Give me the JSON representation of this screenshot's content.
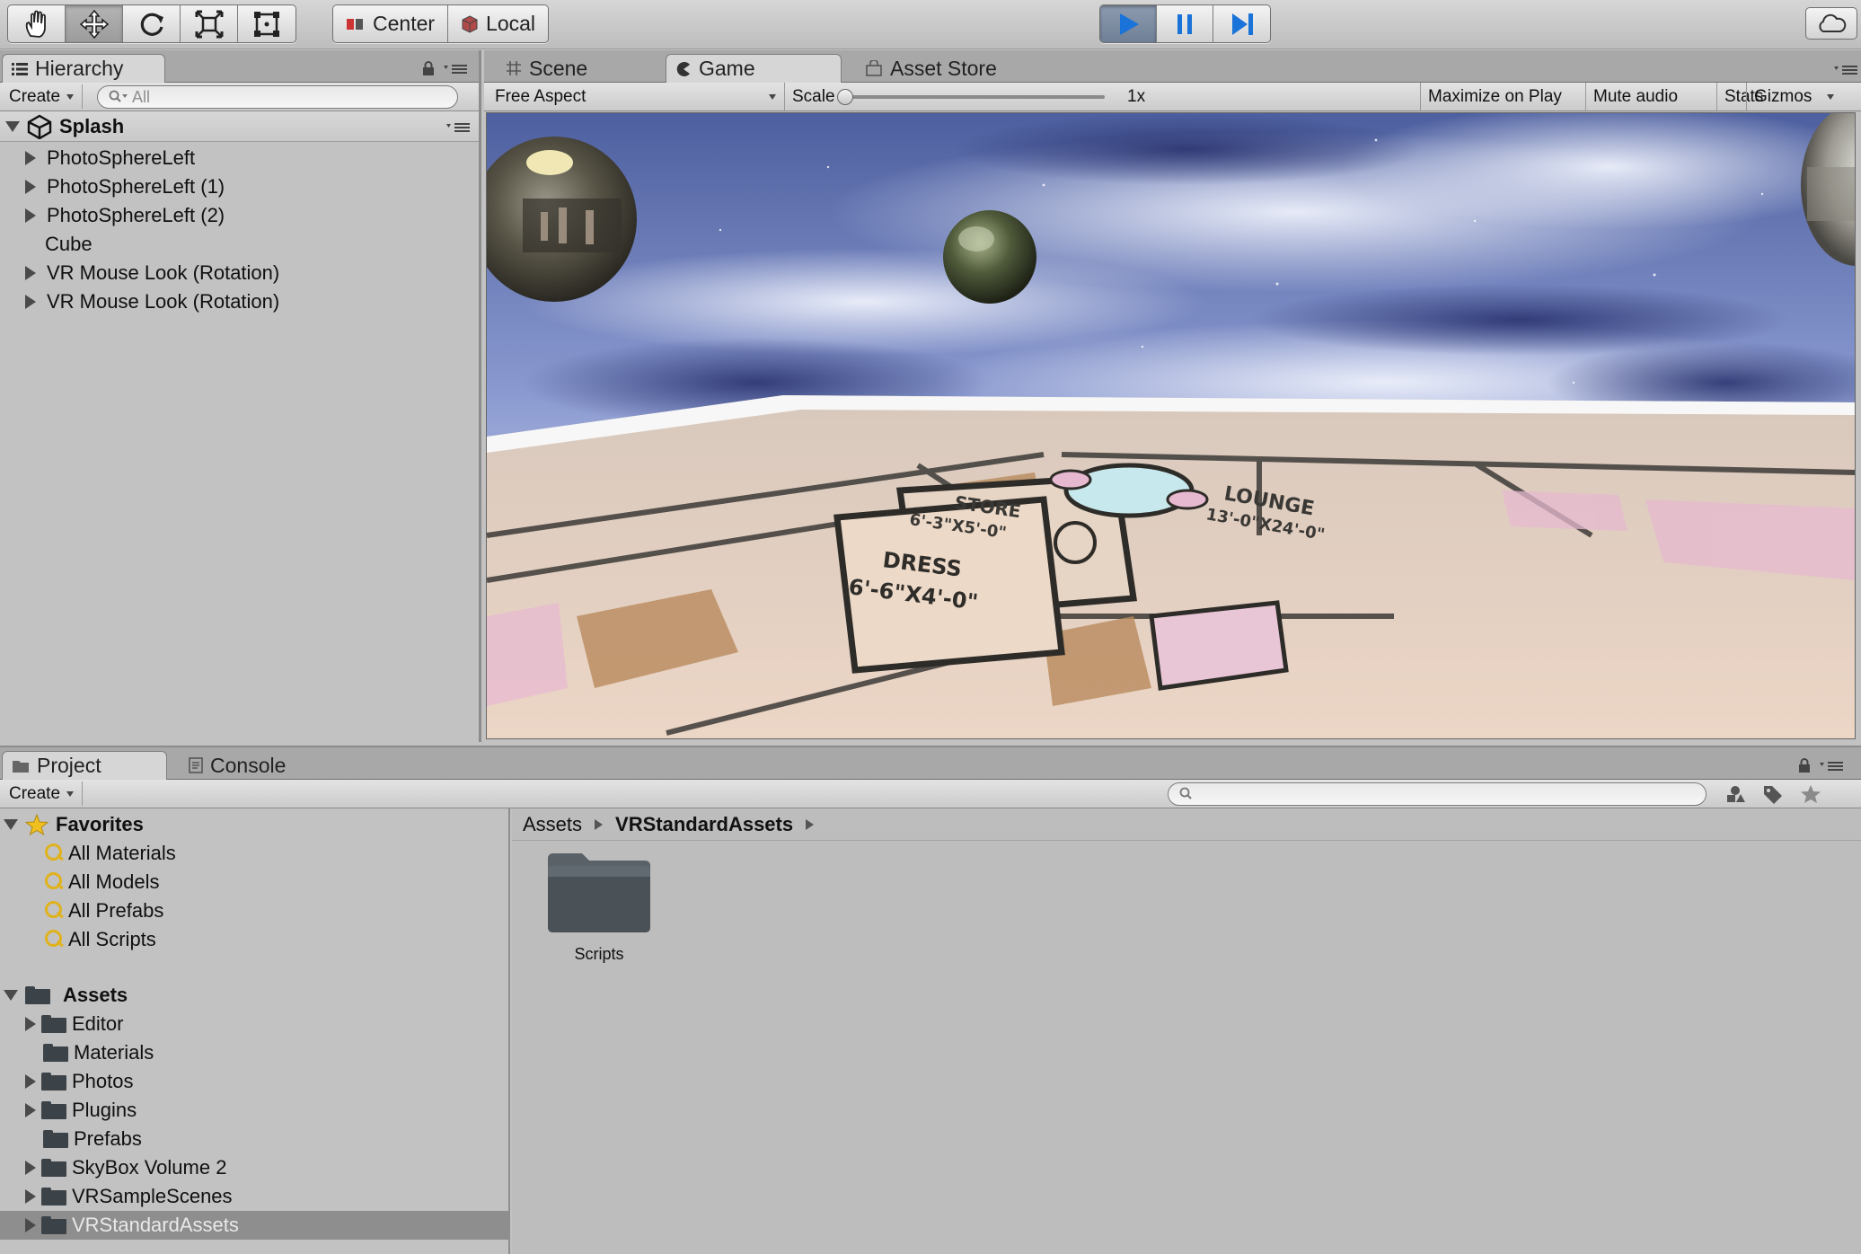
{
  "toolbar": {
    "tools": [
      "hand-tool",
      "move-tool",
      "rotate-tool",
      "scale-tool",
      "rect-tool"
    ],
    "active_tool": "move-tool",
    "pivot_label": "Center",
    "space_label": "Local",
    "play_active": true
  },
  "hierarchy": {
    "tab_label": "Hierarchy",
    "create_label": "Create",
    "search_placeholder": "All",
    "scene_name": "Splash",
    "items": [
      {
        "label": "PhotoSphereLeft",
        "expandable": true
      },
      {
        "label": "PhotoSphereLeft (1)",
        "expandable": true
      },
      {
        "label": "PhotoSphereLeft (2)",
        "expandable": true
      },
      {
        "label": "Cube",
        "expandable": false
      },
      {
        "label": "VR Mouse Look (Rotation)",
        "expandable": true
      },
      {
        "label": "VR Mouse Look (Rotation)",
        "expandable": true
      }
    ]
  },
  "view_tabs": {
    "scene": "Scene",
    "game": "Game",
    "asset_store": "Asset Store"
  },
  "game_bar": {
    "aspect": "Free Aspect",
    "scale_label": "Scale",
    "scale_value": "1x",
    "maximize": "Maximize on Play",
    "mute": "Mute audio",
    "stats": "Stats",
    "gizmos": "Gizmos"
  },
  "game_view": {
    "floor_labels": [
      {
        "name": "STORE",
        "dims": "6'-3\"X5'-0\""
      },
      {
        "name": "DRESS",
        "dims": "6'-6\"X4'-0\""
      },
      {
        "name": "LOUNGE",
        "dims": "13'-0\"X24'-0\""
      }
    ],
    "colors": {
      "sky_top": "#5a6aa8",
      "sky_light": "#c7d2ee",
      "floor": "#e9d3c3"
    }
  },
  "project": {
    "tab_label": "Project",
    "console_label": "Console",
    "create_label": "Create",
    "favorites_label": "Favorites",
    "favorites": [
      "All Materials",
      "All Models",
      "All Prefabs",
      "All Scripts"
    ],
    "assets_label": "Assets",
    "assets": [
      {
        "label": "Editor",
        "expandable": true
      },
      {
        "label": "Materials",
        "expandable": false
      },
      {
        "label": "Photos",
        "expandable": true
      },
      {
        "label": "Plugins",
        "expandable": true
      },
      {
        "label": "Prefabs",
        "expandable": false
      },
      {
        "label": "SkyBox Volume 2",
        "expandable": true
      },
      {
        "label": "VRSampleScenes",
        "expandable": true
      },
      {
        "label": "VRStandardAssets",
        "expandable": true,
        "selected": true
      }
    ],
    "breadcrumb": [
      "Assets",
      "VRStandardAssets"
    ],
    "folder_items": [
      "Scripts"
    ]
  }
}
